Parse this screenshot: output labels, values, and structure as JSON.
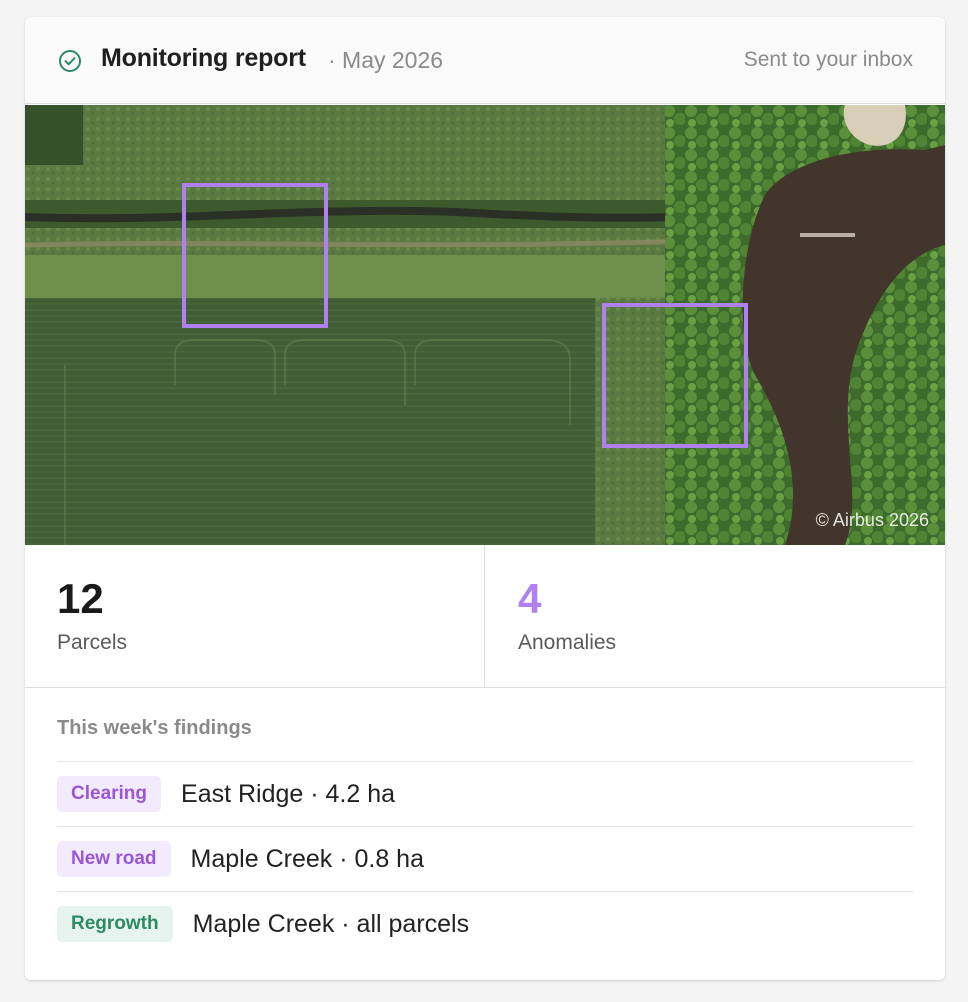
{
  "header": {
    "title": "Monitoring report",
    "date": "· May 2026",
    "status": "Sent to your inbox",
    "icon": "check-circle-icon"
  },
  "imagery": {
    "credit": "© Airbus 2026",
    "highlight_color": "#b07ff0",
    "highlight_count": 2
  },
  "stats": {
    "parcels": {
      "value": "12",
      "label": "Parcels"
    },
    "anomalies": {
      "value": "4",
      "label": "Anomalies",
      "color": "#b07ff0"
    }
  },
  "findings": {
    "title": "This week's findings",
    "items": [
      {
        "tag": "Clearing",
        "tag_color": "purple",
        "text": "East Ridge · 4.2 ha"
      },
      {
        "tag": "New road",
        "tag_color": "purple",
        "text": "Maple Creek · 0.8 ha"
      },
      {
        "tag": "Regrowth",
        "tag_color": "green",
        "text": "Maple Creek · all parcels"
      }
    ]
  },
  "colors": {
    "accent_purple": "#b07ff0",
    "success_green": "#2e8a64"
  }
}
